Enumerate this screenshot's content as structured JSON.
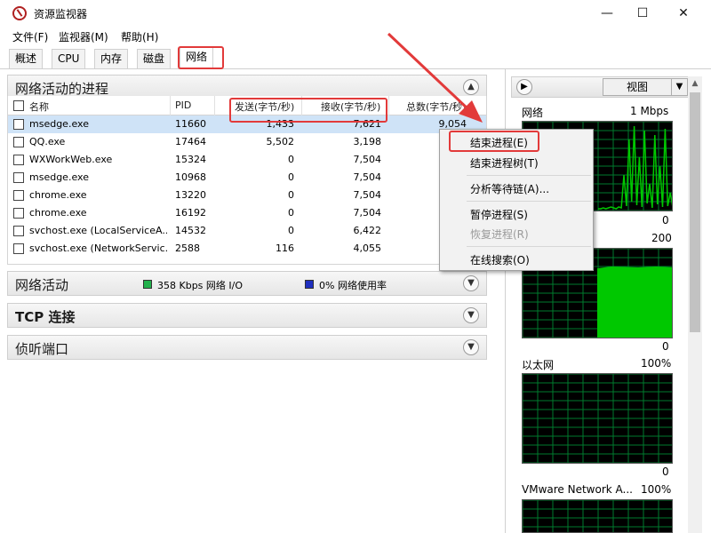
{
  "window": {
    "title": "资源监视器",
    "controls": {
      "minimize": "—",
      "maximize": "☐",
      "close": "✕"
    }
  },
  "menu": [
    "文件(F)",
    "监视器(M)",
    "帮助(H)"
  ],
  "tabs": [
    {
      "label": "概述",
      "active": false
    },
    {
      "label": "CPU",
      "active": false
    },
    {
      "label": "内存",
      "active": false
    },
    {
      "label": "磁盘",
      "active": false
    },
    {
      "label": "网络",
      "active": true
    }
  ],
  "processes": {
    "title": "网络活动的进程",
    "columns": {
      "name": "名称",
      "pid": "PID",
      "send": "发送(字节/秒)",
      "recv": "接收(字节/秒)",
      "total": "总数(字节/秒)"
    },
    "rows": [
      {
        "name": "msedge.exe",
        "pid": "11660",
        "send": "1,433",
        "recv": "7,621",
        "total": "9,054",
        "selected": true
      },
      {
        "name": "QQ.exe",
        "pid": "17464",
        "send": "5,502",
        "recv": "3,198",
        "total": "",
        "selected": false
      },
      {
        "name": "WXWorkWeb.exe",
        "pid": "15324",
        "send": "0",
        "recv": "7,504",
        "total": "",
        "selected": false
      },
      {
        "name": "msedge.exe",
        "pid": "10968",
        "send": "0",
        "recv": "7,504",
        "total": "",
        "selected": false
      },
      {
        "name": "chrome.exe",
        "pid": "13220",
        "send": "0",
        "recv": "7,504",
        "total": "",
        "selected": false
      },
      {
        "name": "chrome.exe",
        "pid": "16192",
        "send": "0",
        "recv": "7,504",
        "total": "",
        "selected": false
      },
      {
        "name": "svchost.exe (LocalServiceA...",
        "pid": "14532",
        "send": "0",
        "recv": "6,422",
        "total": "",
        "selected": false
      },
      {
        "name": "svchost.exe (NetworkServic...",
        "pid": "2588",
        "send": "116",
        "recv": "4,055",
        "total": "",
        "selected": false
      }
    ]
  },
  "network_activity": {
    "title": "网络活动",
    "io_text": "358 Kbps 网络 I/O",
    "usage_text": "0% 网络使用率",
    "io_color": "#22b14c",
    "usage_color": "#1f2fbf"
  },
  "tcp": {
    "title": "TCP 连接"
  },
  "listen": {
    "title": "侦听端口"
  },
  "right": {
    "view_label": "视图",
    "graphs": [
      {
        "label": "网络",
        "scale": "1 Mbps",
        "min": "0"
      },
      {
        "label": "",
        "scale": "200",
        "min": "0"
      },
      {
        "label": "以太网",
        "scale": "100%",
        "min": "0"
      },
      {
        "label": "VMware Network A...",
        "scale": "100%",
        "min": ""
      }
    ]
  },
  "context_menu": [
    {
      "label": "结束进程(E)",
      "disabled": false
    },
    {
      "label": "结束进程树(T)",
      "disabled": false
    },
    {
      "label": "分析等待链(A)...",
      "disabled": false
    },
    {
      "label": "暂停进程(S)",
      "disabled": false
    },
    {
      "label": "恢复进程(R)",
      "disabled": true
    },
    {
      "label": "在线搜索(O)",
      "disabled": false
    }
  ],
  "colors": {
    "highlight": "#e23a3a",
    "graph_green": "#00c800",
    "graph_grid": "#007a2e",
    "selected_row": "#cfe3f7"
  }
}
